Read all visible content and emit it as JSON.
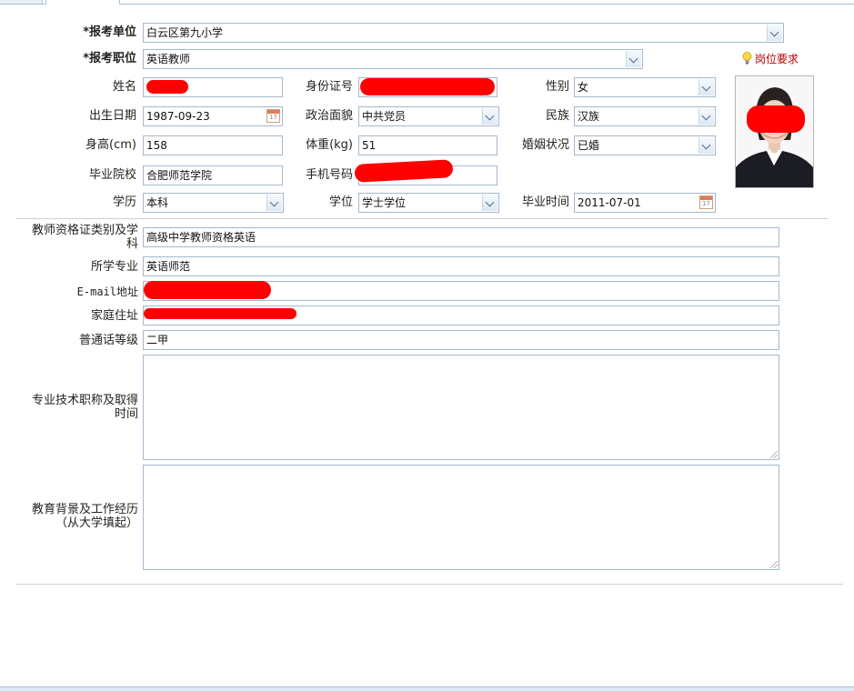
{
  "form": {
    "unit": {
      "label": "*报考单位",
      "value": "白云区第九小学"
    },
    "position": {
      "label": "*报考职位",
      "value": "英语教师"
    },
    "job_requirements_link": "岗位要求",
    "name": {
      "label": "姓名"
    },
    "id_number": {
      "label": "身份证号"
    },
    "gender": {
      "label": "性别",
      "value": "女"
    },
    "birth_date": {
      "label": "出生日期",
      "value": "1987-09-23"
    },
    "political_status": {
      "label": "政治面貌",
      "value": "中共党员"
    },
    "ethnicity": {
      "label": "民族",
      "value": "汉族"
    },
    "height": {
      "label": "身高(cm)",
      "value": "158"
    },
    "weight": {
      "label": "体重(kg)",
      "value": "51"
    },
    "marital_status": {
      "label": "婚姻状况",
      "value": "已婚"
    },
    "school": {
      "label": "毕业院校",
      "value": "合肥师范学院"
    },
    "phone": {
      "label": "手机号码"
    },
    "education": {
      "label": "学历",
      "value": "本科"
    },
    "degree": {
      "label": "学位",
      "value": "学士学位"
    },
    "graduation_date": {
      "label": "毕业时间",
      "value": "2011-07-01"
    },
    "teacher_cert": {
      "label": "教师资格证类别及学科",
      "value": "高级中学教师资格英语"
    },
    "major": {
      "label": "所学专业",
      "value": "英语师范"
    },
    "email": {
      "label": "E-mail地址"
    },
    "address": {
      "label": "家庭住址"
    },
    "mandarin_level": {
      "label": "普通话等级",
      "value": "二甲"
    },
    "professional_title": {
      "label": "专业技术职称及取得时间",
      "value": ""
    },
    "education_background": {
      "label": "教育背景及工作经历（从大学填起）",
      "value": ""
    }
  },
  "colors": {
    "border": "#a5b8cc",
    "redaction": "#ff0000",
    "link": "#c00000"
  }
}
